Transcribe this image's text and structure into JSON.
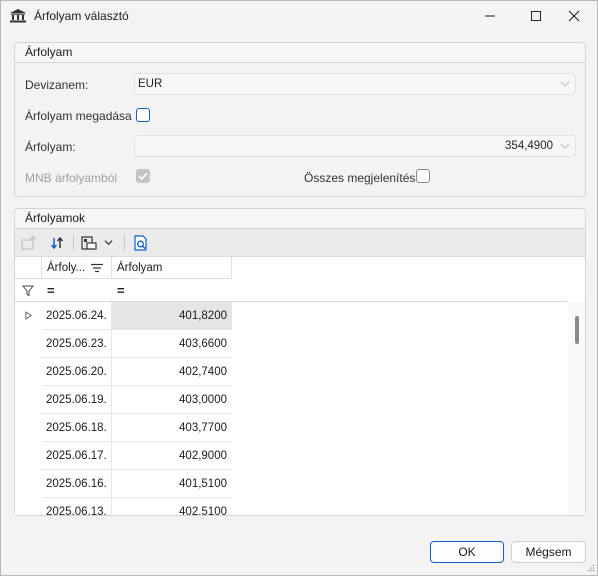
{
  "window": {
    "title": "Árfolyam választó"
  },
  "group1": {
    "header": "Árfolyam",
    "currency_label": "Devizanem:",
    "currency_value": "EUR",
    "manual_label": "Árfolyam megadása",
    "rate_label": "Árfolyam:",
    "rate_value": "354,4900",
    "mnb_label": "MNB árfolyamból",
    "show_all_label": "Összes megjelenítése"
  },
  "group2": {
    "header": "Árfolyamok",
    "columns": [
      "Árfoly...",
      "Árfolyam"
    ],
    "filter_symbols": [
      "=",
      "="
    ],
    "rows": [
      {
        "date": "2025.06.24.",
        "rate": "401,8200"
      },
      {
        "date": "2025.06.23.",
        "rate": "403,6600"
      },
      {
        "date": "2025.06.20.",
        "rate": "402,7400"
      },
      {
        "date": "2025.06.19.",
        "rate": "403,0000"
      },
      {
        "date": "2025.06.18.",
        "rate": "403,7700"
      },
      {
        "date": "2025.06.17.",
        "rate": "402,9000"
      },
      {
        "date": "2025.06.16.",
        "rate": "401,5100"
      },
      {
        "date": "2025.06.13.",
        "rate": "402,5100"
      }
    ]
  },
  "footer": {
    "ok_label": "OK",
    "cancel_label": "Mégsem"
  },
  "colors": {
    "accent": "#0f5ec9",
    "selected_row": "#e5e5e5"
  }
}
